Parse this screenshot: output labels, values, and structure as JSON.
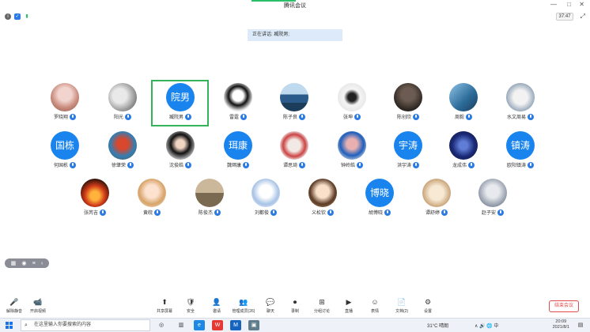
{
  "window": {
    "title": "腾讯会议",
    "controls": {
      "minimize": "—",
      "maximize": "□",
      "close": "✕"
    }
  },
  "subbar": {
    "timer": "37:47",
    "icons": [
      "info-icon",
      "shield-icon",
      "signal-icon"
    ],
    "fullscreen": "⤢"
  },
  "speaking": {
    "text": "正在讲话: 臧院男;"
  },
  "participants": [
    {
      "name": "罗晓翔",
      "avatar_type": "photo",
      "style": "ph1"
    },
    {
      "name": "阳光",
      "avatar_type": "photo",
      "style": "ph2"
    },
    {
      "name": "臧院男",
      "avatar_type": "text",
      "avatar_text": "院男"
    },
    {
      "name": "雷霆",
      "avatar_type": "photo",
      "style": "ph3"
    },
    {
      "name": "陈子良",
      "avatar_type": "photo",
      "style": "ph4"
    },
    {
      "name": "张坤",
      "avatar_type": "photo",
      "style": "ph5"
    },
    {
      "name": "陈创欣",
      "avatar_type": "photo",
      "style": "ph6"
    },
    {
      "name": "周毅",
      "avatar_type": "photo",
      "style": "ph7"
    },
    {
      "name": "水文周易",
      "avatar_type": "photo",
      "style": "ph8"
    },
    {
      "name": "何国栋",
      "avatar_type": "text",
      "avatar_text": "国栋"
    },
    {
      "name": "徐肇荣",
      "avatar_type": "photo",
      "style": "ph9"
    },
    {
      "name": "沈俊皓",
      "avatar_type": "photo",
      "style": "ph10"
    },
    {
      "name": "魏珥康",
      "avatar_type": "text",
      "avatar_text": "珥康"
    },
    {
      "name": "谭思琦",
      "avatar_type": "photo",
      "style": "ph11"
    },
    {
      "name": "钟岭皓",
      "avatar_type": "photo",
      "style": "ph12"
    },
    {
      "name": "洪宇涛",
      "avatar_type": "text",
      "avatar_text": "宇涛"
    },
    {
      "name": "龙成伟",
      "avatar_type": "photo",
      "style": "ph13"
    },
    {
      "name": "欧阳镇涛",
      "avatar_type": "text",
      "avatar_text": "镇涛"
    },
    {
      "name": "张芮吉",
      "avatar_type": "photo",
      "style": "ph14"
    },
    {
      "name": "黄皖",
      "avatar_type": "photo",
      "style": "ph15"
    },
    {
      "name": "陈俊杰",
      "avatar_type": "photo",
      "style": "ph16"
    },
    {
      "name": "刘都俊",
      "avatar_type": "photo",
      "style": "ph17"
    },
    {
      "name": "义松钦",
      "avatar_type": "photo",
      "style": "ph18"
    },
    {
      "name": "胡博晓",
      "avatar_type": "text",
      "avatar_text": "博晓"
    },
    {
      "name": "谭舒婷",
      "avatar_type": "photo",
      "style": "ph19"
    },
    {
      "name": "赵子安",
      "avatar_type": "photo",
      "style": "ph20"
    }
  ],
  "layout_switch": {
    "grid_icon": "▦",
    "speaker_icon": "◉",
    "list_icon": "≡",
    "arrow": "‹"
  },
  "toolbar": {
    "left": [
      {
        "label": "解除静音",
        "icon": "🎤"
      },
      {
        "label": "开启视频",
        "icon": "📹"
      }
    ],
    "center": [
      {
        "label": "共享屏幕",
        "icon": "⬆"
      },
      {
        "label": "安全",
        "icon": "🛡"
      },
      {
        "label": "邀请",
        "icon": "👤"
      },
      {
        "label": "管理成员(26)",
        "icon": "👥"
      },
      {
        "label": "聊天",
        "icon": "💬"
      },
      {
        "label": "录制",
        "icon": "⏺"
      },
      {
        "label": "分组讨论",
        "icon": "⊞"
      },
      {
        "label": "直播",
        "icon": "▶"
      },
      {
        "label": "表情",
        "icon": "☺"
      },
      {
        "label": "文档(2)",
        "icon": "📄"
      },
      {
        "label": "设置",
        "icon": "⚙"
      }
    ],
    "end_meeting": "结束会议"
  },
  "taskbar": {
    "search_placeholder": "在这里输入你要搜索的内容",
    "apps": [
      "◎",
      "▥",
      "e",
      "W",
      "M",
      "▣"
    ],
    "weather": "31°C 晴朗",
    "tray": "∧ 🔊 🌐 中",
    "time": "20:09",
    "date": "2021/8/1",
    "notif": "▤"
  },
  "colors": {
    "accent_blue": "#1a84ee",
    "highlight_green": "#35b35a",
    "end_red": "#e14b4b"
  }
}
